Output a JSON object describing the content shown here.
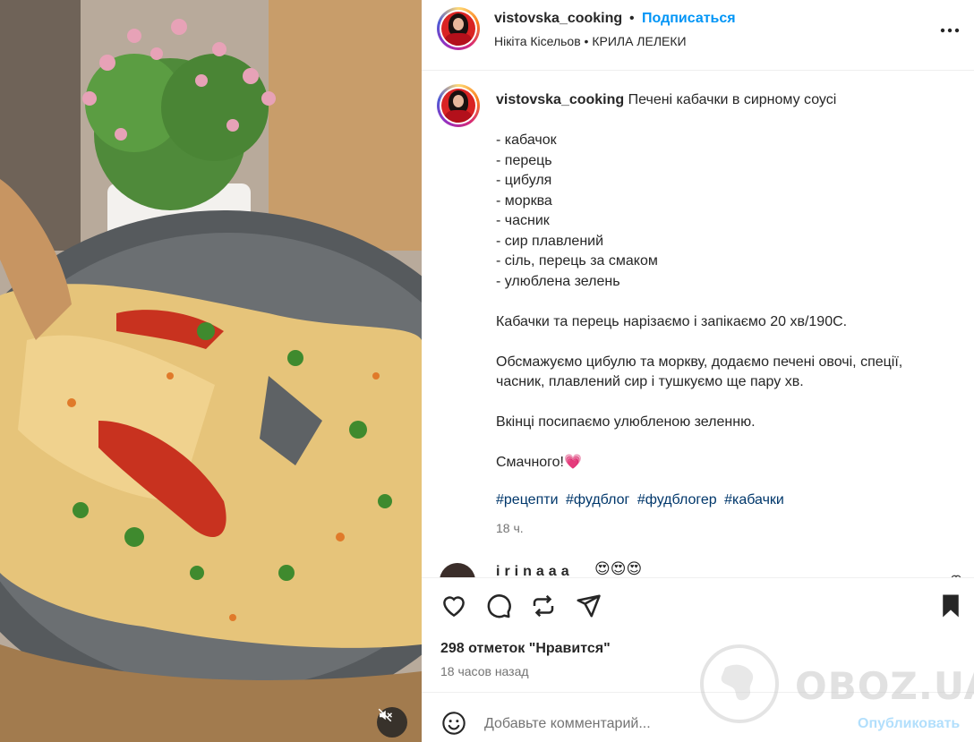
{
  "post": {
    "username": "vistovska_cooking",
    "separator": "•",
    "follow_label": "Подписаться",
    "audio": "Нікіта Кісельов • КРИЛА ЛЕЛЕКИ"
  },
  "caption": {
    "username": "vistovska_cooking",
    "text": " Печені кабачки в сирному соусі\n\n- кабачок\n- перець\n- цибуля\n- морква\n- часник\n- сир плавлений\n- сіль, перець за смаком\n- улюблена зелень\n\nКабачки та перець нарізаємо і запікаємо 20 хв/190С.\n\nОбсмажуємо цибулю та моркву, додаємо печені овочі, спеції,\nчасник, плавлений сир і тушкуємо ще пару хв.\n\nВкінці посипаємо улюбленою зеленню.\n\nСмачного!💗",
    "hashtags": [
      "#рецепти",
      "#фудблог",
      "#фудблогер",
      "#кабачки"
    ],
    "time": "18 ч."
  },
  "next_comment": {
    "username": "irinaaa",
    "emoji": "😍😍😍"
  },
  "engagement": {
    "likes": "298 отметок \"Нравится\"",
    "posted_ago": "18 часов назад"
  },
  "comment_box": {
    "placeholder": "Добавьте комментарий...",
    "publish_label": "Опубликовать"
  },
  "watermark": {
    "text": "OBOZ.UA"
  },
  "icons": {
    "more": "more-horizontal-icon",
    "like": "heart-icon",
    "comment": "comment-bubble-icon",
    "repost": "repost-icon",
    "share": "send-icon",
    "save": "bookmark-filled-icon",
    "emoji": "emoji-smile-icon",
    "mute": "muted-speaker-icon"
  },
  "colors": {
    "link_blue": "#0095f6",
    "hashtag": "#00376b",
    "muted_text": "#737373",
    "publish_disabled": "#b2dffc"
  }
}
